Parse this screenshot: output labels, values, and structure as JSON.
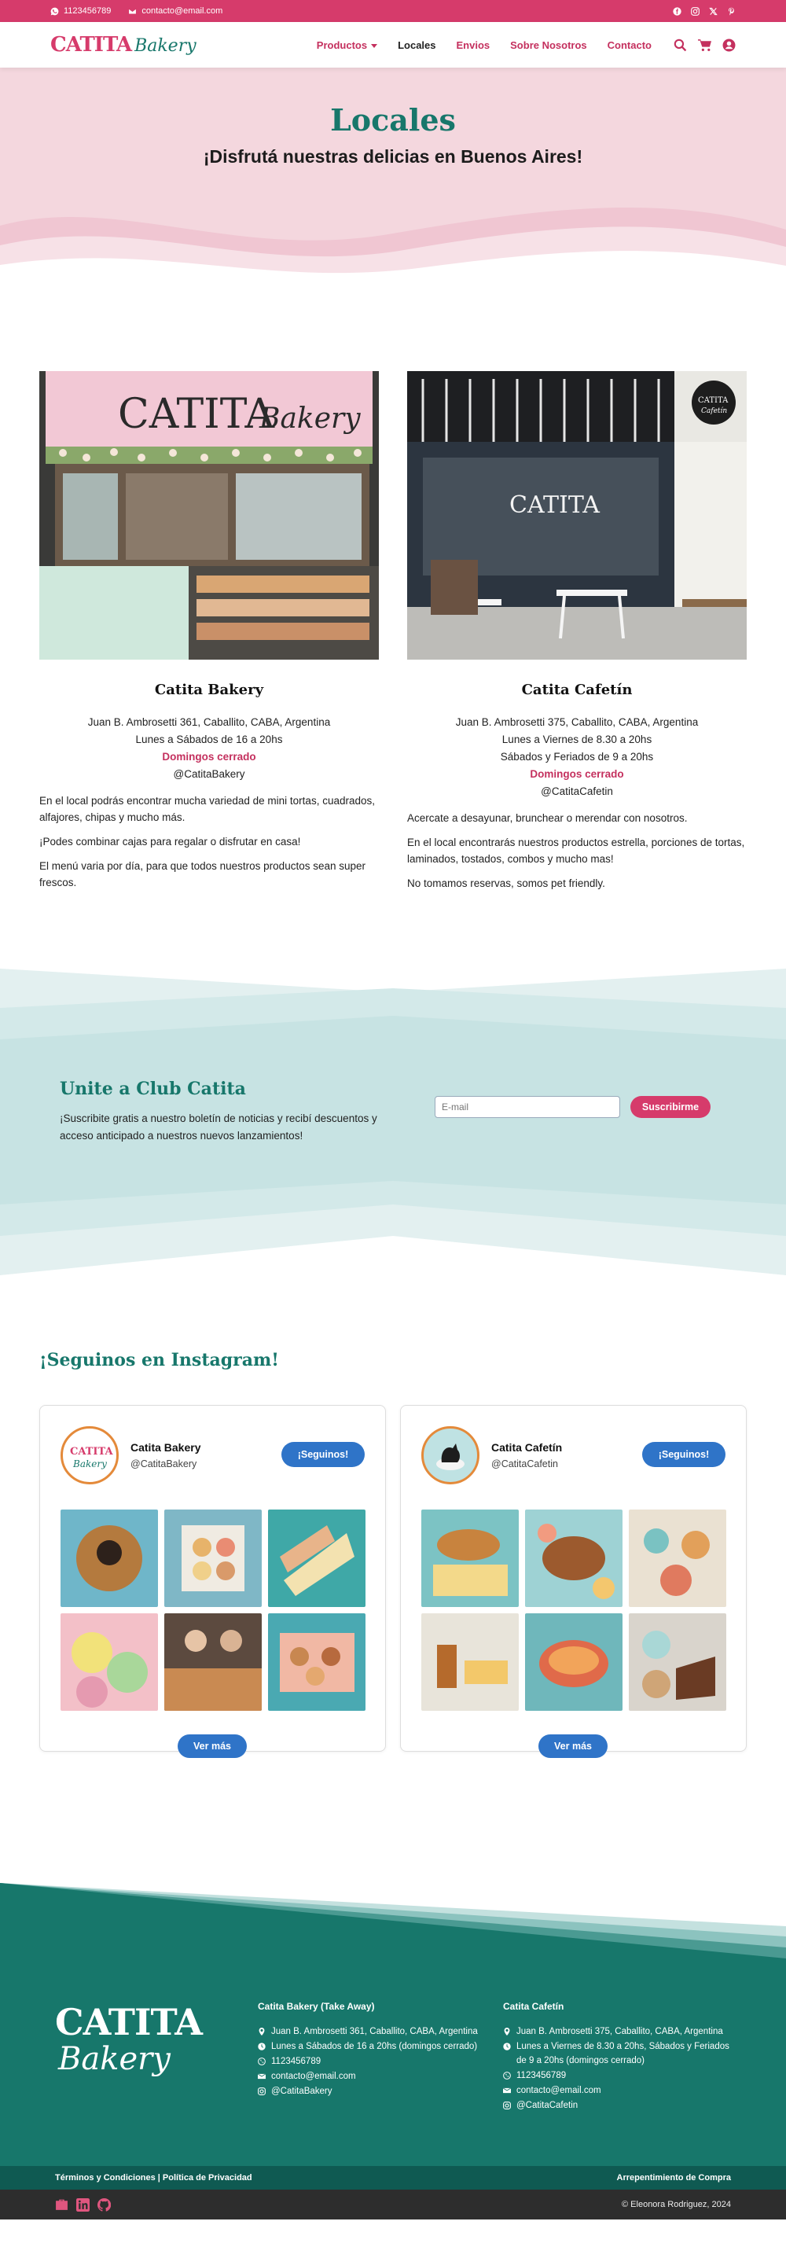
{
  "topbar": {
    "phone": "1123456789",
    "email": "contacto@email.com",
    "social": [
      "facebook-icon",
      "instagram-icon",
      "x-icon",
      "pinterest-icon"
    ]
  },
  "nav": {
    "logo_main": "CATITA",
    "logo_script": "Bakery",
    "items": [
      "Productos",
      "Locales",
      "Envios",
      "Sobre Nosotros",
      "Contacto"
    ],
    "active": "Locales",
    "icons": [
      "search-icon",
      "cart-icon",
      "user-icon"
    ]
  },
  "hero": {
    "title": "Locales",
    "subtitle": "¡Disfrutá nuestras delicias en Buenos Aires!"
  },
  "stores": [
    {
      "name": "Catita Bakery",
      "sign_main": "CATITA",
      "sign_script": "Bakery",
      "address": "Juan B. Ambrosetti 361, Caballito, CABA, Argentina",
      "hours": [
        "Lunes a Sábados de 16 a 20hs"
      ],
      "closed": "Domingos cerrado",
      "handle": "@CatitaBakery",
      "description": [
        "En el local podrás encontrar mucha variedad de mini tortas, cuadrados, alfajores, chipas y mucho más.",
        "¡Podes combinar cajas para regalar o disfrutar en casa!",
        "El menú varia por día, para que todos nuestros productos sean super frescos."
      ]
    },
    {
      "name": "Catita Cafetín",
      "sign_main": "CATITA",
      "sign_script": "Cafetín",
      "address": "Juan B. Ambrosetti 375, Caballito, CABA, Argentina",
      "hours": [
        "Lunes a Viernes de 8.30 a 20hs",
        "Sábados y Feriados de 9 a 20hs"
      ],
      "closed": "Domingos cerrado",
      "handle": "@CatitaCafetin",
      "description": [
        "Acercate a desayunar, brunchear o merendar con nosotros.",
        "En el local encontrarás nuestros productos estrella, porciones de tortas, laminados, tostados, combos y mucho mas!",
        "No tomamos reservas, somos pet friendly."
      ]
    }
  ],
  "newsletter": {
    "title": "Unite a Club Catita",
    "text": "¡Suscribite gratis a nuestro boletín de noticias y recibí descuentos y acceso anticipado a nuestros nuevos lanzamientos!",
    "placeholder": "E-mail",
    "button": "Suscribirme"
  },
  "instagram": {
    "title": "¡Seguinos en Instagram!",
    "accounts": [
      {
        "name": "Catita Bakery",
        "handle": "@CatitaBakery",
        "avatar_main": "CATITA",
        "avatar_script": "Bakery",
        "follow": "¡Seguinos!",
        "more": "Ver más"
      },
      {
        "name": "Catita Cafetín",
        "handle": "@CatitaCafetin",
        "follow": "¡Seguinos!",
        "more": "Ver más"
      }
    ]
  },
  "footer": {
    "logo_main": "CATITA",
    "logo_script": "Bakery",
    "col1": {
      "title": "Catita Bakery (Take Away)",
      "address": "Juan B. Ambrosetti 361, Caballito, CABA, Argentina",
      "hours": "Lunes a Sábados de 16 a 20hs (domingos cerrado)",
      "phone": "1123456789",
      "email": "contacto@email.com",
      "instagram": "@CatitaBakery"
    },
    "col2": {
      "title": "Catita Cafetín",
      "address": "Juan B. Ambrosetti 375, Caballito, CABA, Argentina",
      "hours": "Lunes a Viernes de 8.30 a 20hs, Sábados y Feriados de 9 a 20hs (domingos cerrado)",
      "phone": "1123456789",
      "email": "contacto@email.com",
      "instagram": "@CatitaCafetin"
    },
    "legal_left": "Términos y Condiciones | Política de Privacidad",
    "legal_right": "Arrepentimiento de Compra",
    "copyright": "© Eleonora Rodriguez, 2024",
    "bottom_icons": [
      "briefcase-icon",
      "linkedin-icon",
      "github-icon"
    ]
  },
  "colors": {
    "brand_pink": "#d63b6b",
    "brand_teal": "#17776b",
    "hero_bg": "#f4d7de",
    "newsletter_bg": "#c7e3e3",
    "button_blue": "#2f74c8"
  }
}
